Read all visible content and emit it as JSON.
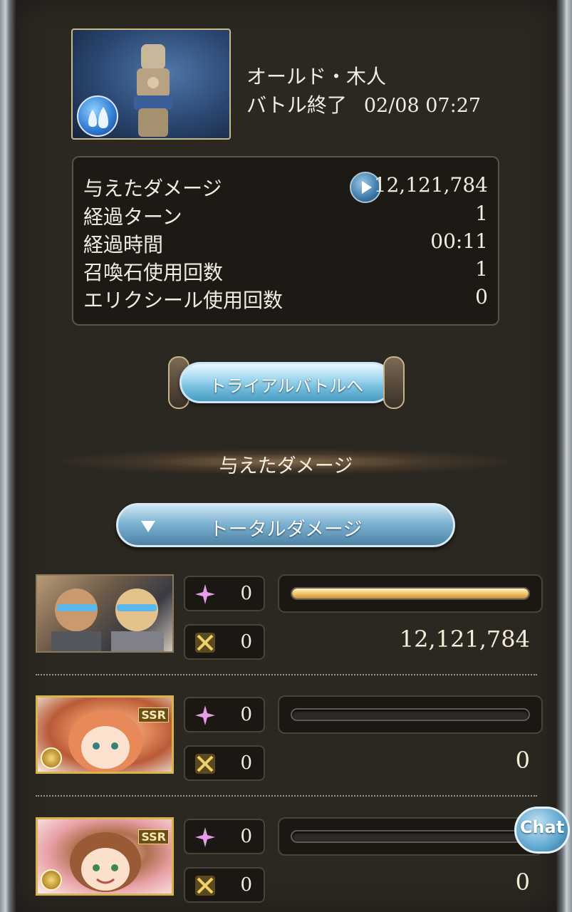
{
  "boss": {
    "name": "オールド・木人",
    "status": "バトル終了",
    "time": "02/08 07:27"
  },
  "stats": {
    "rows": [
      {
        "label": "与えたダメージ",
        "value": "12,121,784"
      },
      {
        "label": "経過ターン",
        "value": "1"
      },
      {
        "label": "経過時間",
        "value": "00:11"
      },
      {
        "label": "召喚石使用回数",
        "value": "1"
      },
      {
        "label": "エリクシール使用回数",
        "value": "0"
      }
    ]
  },
  "trial_button": {
    "label": "トライアルバトルへ"
  },
  "section": {
    "title": "与えたダメージ"
  },
  "dropdown": {
    "label": "トータルダメージ"
  },
  "members": [
    {
      "skill_count": "0",
      "ability_count": "0",
      "damage": "12,121,784",
      "bar_fraction": 1.0,
      "ssr": false
    },
    {
      "skill_count": "0",
      "ability_count": "0",
      "damage": "0",
      "bar_fraction": 0.0,
      "ssr": true,
      "rarity": "SSR"
    },
    {
      "skill_count": "0",
      "ability_count": "0",
      "damage": "0",
      "bar_fraction": 0.0,
      "ssr": true,
      "rarity": "SSR"
    }
  ],
  "chat": {
    "label": "Chat"
  },
  "colors": {
    "bar_fill": "#f0c66e",
    "button_blue": "#7fb3d2",
    "panel_bg": "#2b2721"
  }
}
